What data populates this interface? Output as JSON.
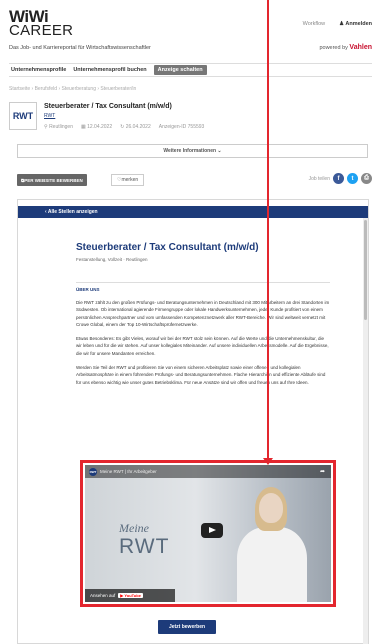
{
  "header": {
    "logo_line1": "WiWi",
    "logo_line2": "CAREER",
    "nav_link": "Workflow",
    "login": "Anmelden",
    "tagline": "Das Job- und Karriereportal für Wirtschaftswissenschaftler",
    "powered_prefix": "powered by",
    "powered_brand": "Vahlen"
  },
  "subnav": {
    "items": [
      "Unternehmensprofile",
      "Unternehmensprofil buchen"
    ],
    "cta": "Anzeige schalten"
  },
  "breadcrumb": "Startseite › Berufsfeld › Steuerberatung › Steuerberater/in",
  "job": {
    "logo_text": "RWT",
    "title": "Steuerberater / Tax Consultant (m/w/d)",
    "company": "RWT",
    "location": "Reutlingen",
    "date_posted": "12.04.2022",
    "date_updated": "26.04.2022",
    "ad_id": "Anzeigen-ID 755593"
  },
  "more_info": "Weitere Informationen",
  "actions": {
    "apply_web": "PER WEBSITE BEWERBEN",
    "mark": "merken",
    "share_label": "Job teilen"
  },
  "listing": {
    "back": "‹  Alle Stellen anzeigen",
    "title": "Steuerberater / Tax Consultant (m/w/d)",
    "subtitle": "Festanstellung, Vollzeit · Reutlingen",
    "section": "ÜBER UNS",
    "p1": "Die RWT zählt zu den großen Prüfungs- und Beratungsunternehmen in Deutschland mit 300 Mitarbeitern an drei Standorten im Südwesten. Ob international agierende Firmengruppe oder lokale Handwerksunternehmen, jeder Kunde profitiert von einem persönlichen Ansprechpartner und vom umfassenden Kompetenznetzwerk aller RWT-Bereiche. Wir sind weltweit vernetzt mit Crowe Global, einem der Top 10-Wirtschaftsprüfernetzwerke.",
    "p2": "Etwas Besonderes: Es gibt Vieles, worauf wir bei der RWT stolz sein können. Auf die Werte und die Unternehmenskultur, die wir leben und für die wir stehen. Auf unser kollegiales Miteinander. Auf unsere individuellen Arbeitsmodelle. Auf die Ergebnisse, die wir für unsere Mandanten erreichen.",
    "p3": "Werden Sie Teil der RWT und profitieren Sie von einem sicheren Arbeitsplatz sowie einer offenen und kollegialen Arbeitsatmosphäre in einem führenden Prüfungs- und Beratungsunternehmen. Flache Hierarchien und effiziente Abläufe sind für uns ebenso wichtig wie unser gutes Betriebsklima. Für neue Ansätze sind wir offen und freuen uns auf Ihre Ideen.",
    "apply": "Jetzt bewerben"
  },
  "video": {
    "channel": "RWT",
    "name": "Meine RWT | Ihr Arbeitgeber",
    "meine": "Meine",
    "rwt": "RWT",
    "watch_on": "Ansehen auf",
    "yt": "YouTube"
  },
  "colors": {
    "brand_blue": "#1d3b7a",
    "highlight_red": "#e3262e"
  }
}
